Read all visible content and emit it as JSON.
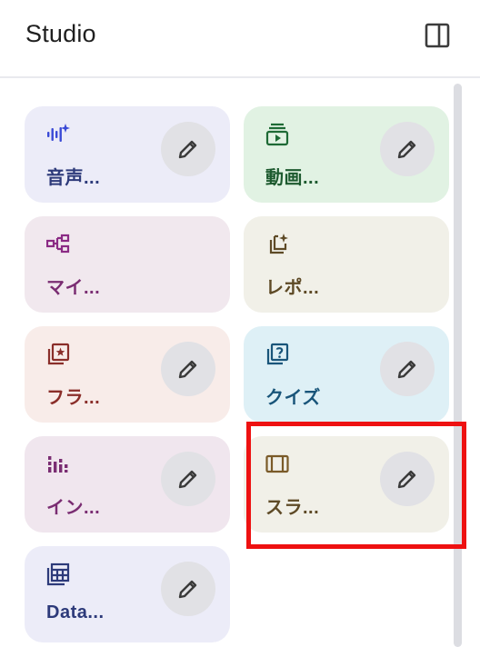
{
  "header": {
    "title": "Studio",
    "panel_icon": "side-panel-icon"
  },
  "cards": {
    "audio": {
      "label": "音声...",
      "icon": "audio-waveform-icon",
      "color": "#3a4ad6",
      "bg": "#ececf8",
      "editable": true
    },
    "video": {
      "label": "動画...",
      "icon": "video-play-icon",
      "color": "#1d6a35",
      "bg": "#e1f2e3",
      "editable": true
    },
    "mindmap": {
      "label": "マイ...",
      "icon": "mindmap-icon",
      "color": "#8b2a84",
      "bg": "#f1e8ee",
      "editable": false
    },
    "report": {
      "label": "レポ...",
      "icon": "report-sparkle-icon",
      "color": "#5e4a26",
      "bg": "#f1f0e8",
      "editable": false
    },
    "flash": {
      "label": "フラ...",
      "icon": "flashcards-icon",
      "color": "#8a2e2a",
      "bg": "#f8ece9",
      "editable": true
    },
    "quiz": {
      "label": "クイズ",
      "icon": "quiz-icon",
      "color": "#19557a",
      "bg": "#def0f6",
      "editable": true
    },
    "info": {
      "label": "イン...",
      "icon": "infographic-icon",
      "color": "#7a2d72",
      "bg": "#f0e6ee",
      "editable": true
    },
    "slides": {
      "label": "スラ...",
      "icon": "slides-icon",
      "color": "#7a5a28",
      "bg": "#f1f0e8",
      "editable": true
    },
    "data": {
      "label": "Data...",
      "icon": "data-table-icon",
      "color": "#2d3a7a",
      "bg": "#ececf8",
      "editable": true
    }
  },
  "edit_icon": "pencil-edit-icon",
  "highlight_color": "#ee1111"
}
